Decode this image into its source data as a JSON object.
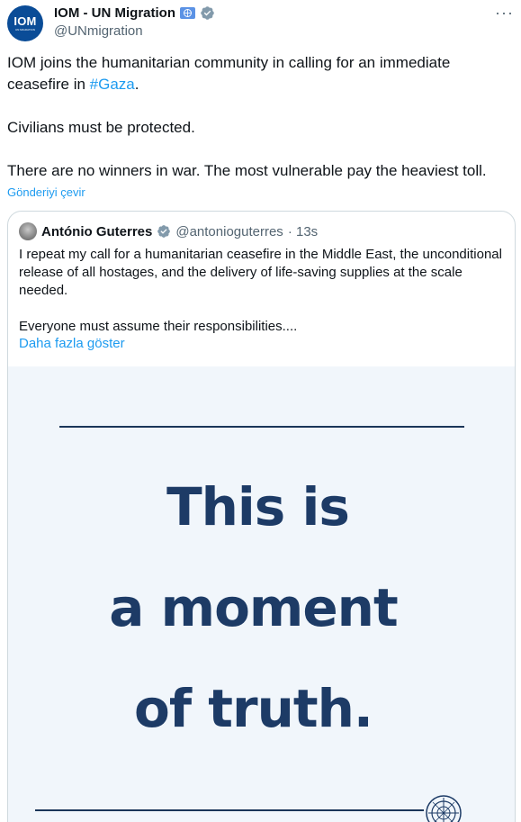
{
  "post": {
    "avatar_text": "IOM",
    "avatar_subtext": "UN MIGRATION",
    "display_name": "IOM - UN Migration",
    "handle": "@UNmigration",
    "more_icon": "more-icon",
    "text_p1_before": "IOM joins the humanitarian community in calling for an immediate ceasefire in ",
    "hashtag": "#Gaza",
    "text_p1_after": ".",
    "text_p2": "Civilians must be protected.",
    "text_p3": "There are no winners in war. The most vulnerable pay the heaviest toll.",
    "translate_label": "Gönderiyi çevir"
  },
  "quote": {
    "display_name": "António Guterres",
    "handle": "@antonioguterres",
    "time": "· 13s",
    "text_p1": "I repeat my call for a humanitarian ceasefire in the Middle East, the unconditional release of all hostages, and the delivery of life-saving supplies at the scale needed.",
    "text_p2": "Everyone must assume their responsibilities....",
    "show_more": "Daha fazla göster",
    "image": {
      "line1": "This is",
      "line2": "a moment",
      "line3": "of truth."
    }
  },
  "colors": {
    "link": "#1d9bf0",
    "secondary_text": "#536471",
    "image_text": "#1d3b66",
    "image_bg": "#f1f6fb"
  }
}
